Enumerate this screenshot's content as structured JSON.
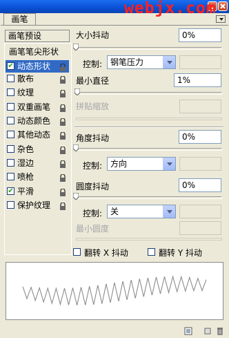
{
  "window": {
    "watermark": "webjx.com",
    "tab_label": "画笔"
  },
  "sidebar": {
    "preset_label": "画笔预设",
    "tip_shape_label": "画笔笔尖形状",
    "items": [
      {
        "label": "动态形状",
        "checked": true,
        "selected": true
      },
      {
        "label": "散布",
        "checked": false
      },
      {
        "label": "纹理",
        "checked": false
      },
      {
        "label": "双重画笔",
        "checked": false
      },
      {
        "label": "动态颜色",
        "checked": false
      },
      {
        "label": "其他动态",
        "checked": false
      },
      {
        "label": "杂色",
        "checked": false
      },
      {
        "label": "湿边",
        "checked": false
      },
      {
        "label": "喷枪",
        "checked": false
      },
      {
        "label": "平滑",
        "checked": true
      },
      {
        "label": "保护纹理",
        "checked": false
      }
    ]
  },
  "settings": {
    "size_jitter": {
      "label": "大小抖动",
      "value": "0%",
      "slider": 0
    },
    "size_control": {
      "label": "控制:",
      "value": "钢笔压力",
      "extra": ""
    },
    "min_diameter": {
      "label": "最小直径",
      "value": "1%",
      "slider": 1
    },
    "tilt_scale": {
      "label": "拼贴缩放",
      "value": ""
    },
    "angle_jitter": {
      "label": "角度抖动",
      "value": "0%",
      "slider": 0
    },
    "angle_control": {
      "label": "控制:",
      "value": "方向",
      "extra": ""
    },
    "roundness_jitter": {
      "label": "圆度抖动",
      "value": "0%",
      "slider": 0
    },
    "roundness_control": {
      "label": "控制:",
      "value": "关",
      "extra": ""
    },
    "min_roundness": {
      "label": "最小圆度",
      "value": ""
    },
    "flip_x": {
      "label": "翻转 X 抖动",
      "checked": false
    },
    "flip_y": {
      "label": "翻转 Y 抖动",
      "checked": false
    }
  },
  "icons": {
    "check": "✔",
    "lock": "lock-icon",
    "new": "new-brush-icon",
    "delete": "trash-icon"
  },
  "colors": {
    "title": "#0a52d6",
    "selected": "#316ac5",
    "watermark": "#ff2020"
  }
}
